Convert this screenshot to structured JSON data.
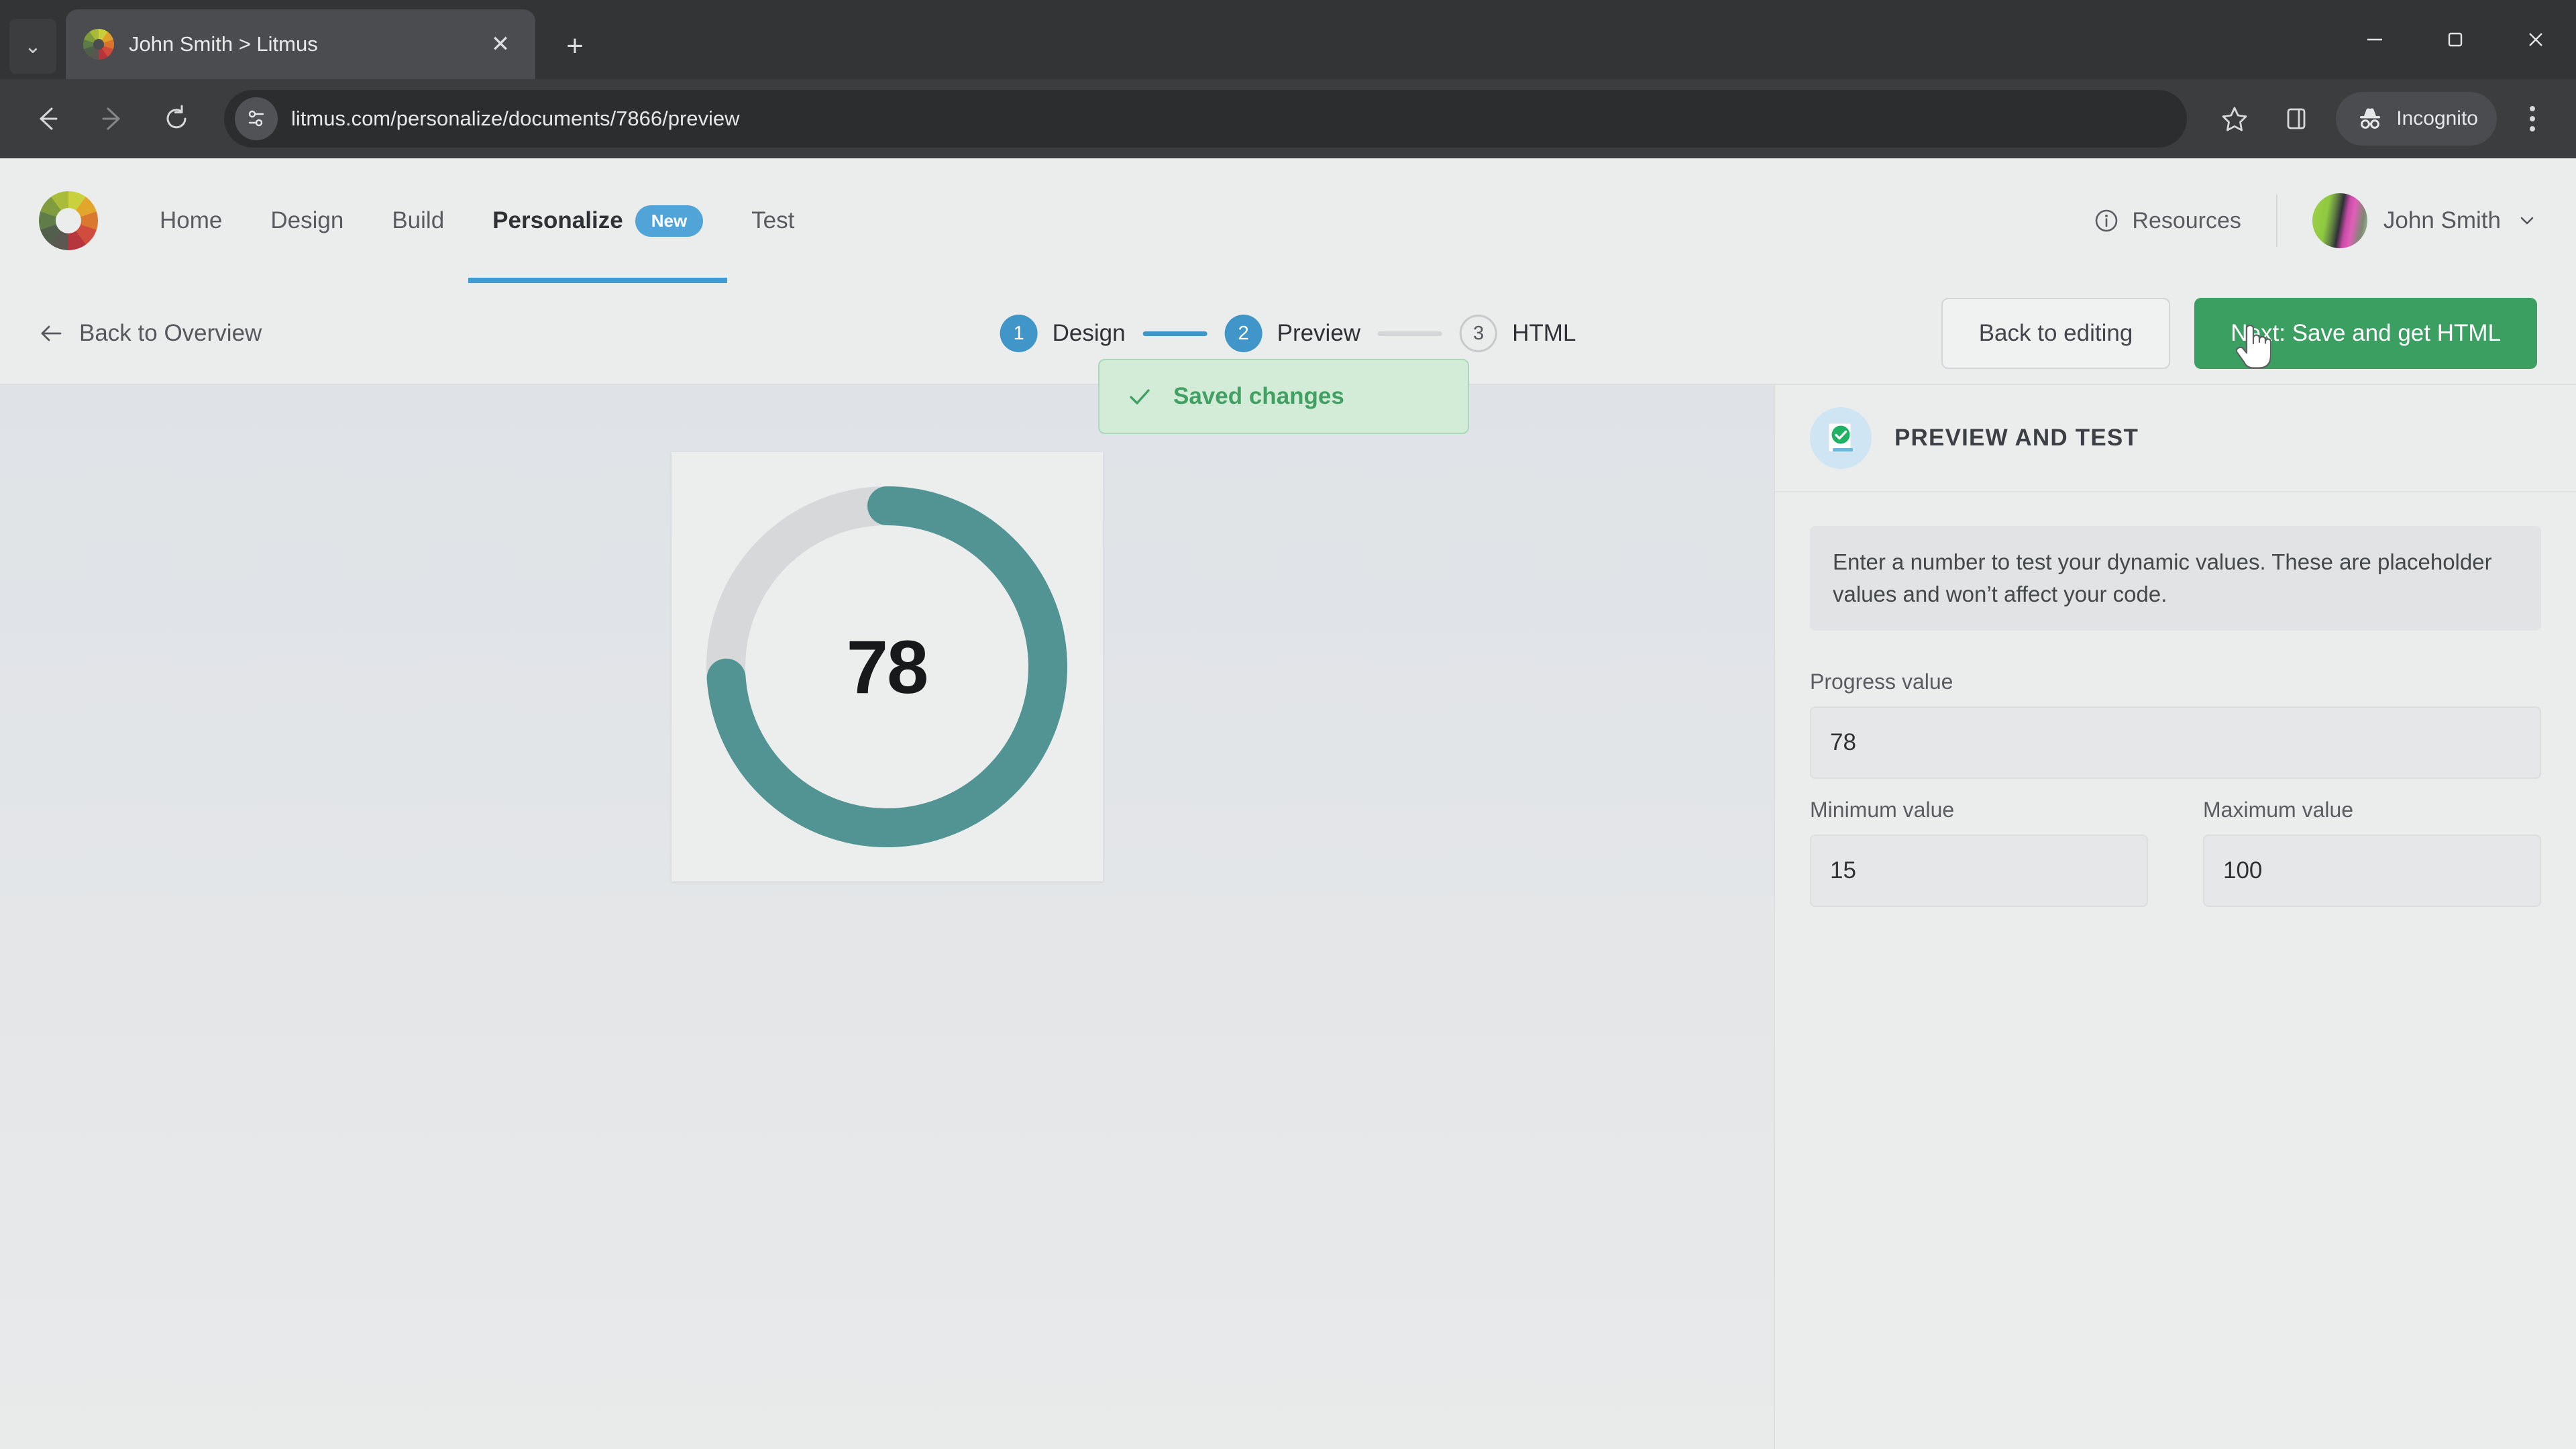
{
  "browser": {
    "tab": {
      "title": "John Smith > Litmus",
      "favicon": "litmus-color-wheel-icon",
      "close_label": "✕"
    },
    "tablist_chevron": "⌄",
    "new_tab_label": "+",
    "window_controls": {
      "minimize": "—",
      "maximize": "❐",
      "close": "✕"
    },
    "nav": {
      "back": "←",
      "forward": "→",
      "reload": "↻"
    },
    "omnibox": {
      "url": "litmus.com/personalize/documents/7866/preview",
      "site_info_icon": "site-settings-icon"
    },
    "actions": {
      "bookmark": "bookmark-star-icon",
      "side_panel": "side-panel-icon",
      "incognito_label": "Incognito",
      "menu": "three-dot-menu-icon"
    }
  },
  "app": {
    "logo": "litmus-logo",
    "nav_items": [
      {
        "label": "Home",
        "active": false
      },
      {
        "label": "Design",
        "active": false
      },
      {
        "label": "Build",
        "active": false
      },
      {
        "label": "Personalize",
        "active": true,
        "badge": "New"
      },
      {
        "label": "Test",
        "active": false
      }
    ],
    "resources_label": "Resources",
    "user": {
      "name": "John Smith",
      "chevron": "⌄"
    }
  },
  "subbar": {
    "back_link": "Back to Overview",
    "back_arrow": "←",
    "steps": [
      {
        "num": "1",
        "label": "Design",
        "state": "done"
      },
      {
        "num": "2",
        "label": "Preview",
        "state": "done"
      },
      {
        "num": "3",
        "label": "HTML",
        "state": "todo"
      }
    ],
    "secondary_button": "Back to editing",
    "primary_button": "Next: Save and get HTML"
  },
  "toast": {
    "icon": "check-icon",
    "message": "Saved changes"
  },
  "panel": {
    "title": "PREVIEW AND TEST",
    "icon": "document-check-icon",
    "info_text": "Enter a number to test your dynamic values. These are placeholder values and won’t affect your code.",
    "fields": [
      {
        "label": "Progress value",
        "value": "78"
      },
      {
        "label": "Minimum value",
        "value": "15"
      },
      {
        "label": "Maximum value",
        "value": "100"
      }
    ]
  },
  "chart_data": {
    "type": "pie",
    "title": "",
    "variant": "donut-progress-gauge",
    "value": 78,
    "min": 15,
    "max": 100,
    "percent_filled": 74,
    "display_label": "78",
    "start_angle_deg": 0,
    "sweep_deg": 266,
    "colors": {
      "progress": "#529494",
      "track": "#d7d8d9",
      "label": "#17191a",
      "card_background": "#eceded"
    },
    "legend": null,
    "grid": false
  },
  "colors": {
    "accent_blue": "#3e9bd4",
    "primary_green": "#3c9f62",
    "toast_green": "#43a063",
    "toast_bg": "#d2ecd8",
    "progress_teal": "#529494",
    "chrome_dark": "#3c3d3f"
  }
}
